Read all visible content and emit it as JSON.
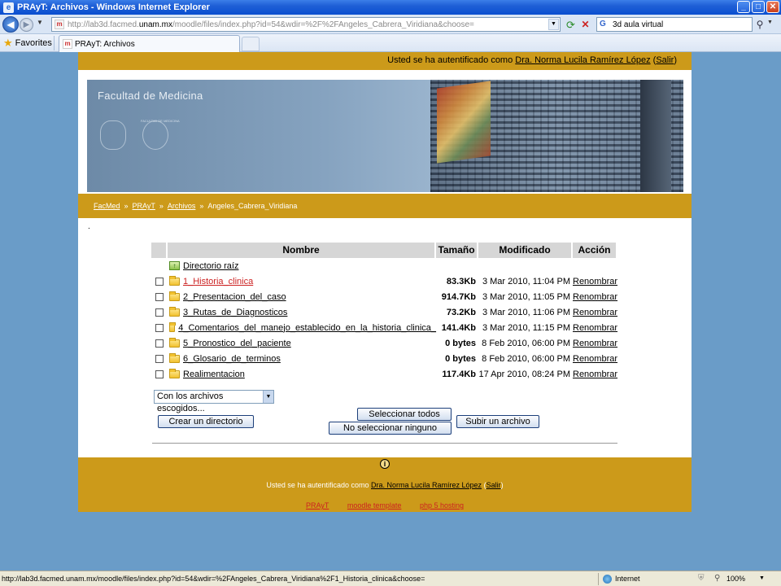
{
  "window": {
    "title": "PRAyT: Archivos - Windows Internet Explorer",
    "app_icon": "ie-icon"
  },
  "address": {
    "url_prefix": "http://lab3d.facmed.",
    "url_host": "unam.mx",
    "url_suffix": "/moodle/files/index.php?id=54&wdir=%2F%2FAngeles_Cabrera_Viridiana&choose=",
    "search_text": "3d aula virtual"
  },
  "favbar": {
    "favorites_label": "Favorites",
    "tab_label": "PRAyT: Archivos"
  },
  "page": {
    "auth_prefix": "Usted se ha autentificado como ",
    "auth_user": "Dra. Norma Lucila Ramírez López",
    "auth_logout": "Salir",
    "faculty_title": "Facultad de Medicina",
    "seal_label": "FACULTAD DE MEDICINA",
    "breadcrumb": [
      "FacMed",
      "PRAyT",
      "Archivos",
      "Angeles_Cabrera_Viridiana"
    ],
    "breadcrumb_sep": "»",
    "dot": "."
  },
  "table": {
    "headers": [
      "Nombre",
      "Tamaño",
      "Modificado",
      "Acción"
    ],
    "parent_label": " Directorio raíz",
    "rows": [
      {
        "name": " 1_Historia_clinica",
        "size": "83.3Kb",
        "modified": "3 Mar 2010, 11:04 PM",
        "action": "Renombrar",
        "highlight": true
      },
      {
        "name": " 2_Presentacion_del_caso",
        "size": "914.7Kb",
        "modified": "3 Mar 2010, 11:05 PM",
        "action": "Renombrar",
        "highlight": false
      },
      {
        "name": " 3_Rutas_de_Diagnosticos",
        "size": "73.2Kb",
        "modified": "3 Mar 2010, 11:06 PM",
        "action": "Renombrar",
        "highlight": false
      },
      {
        "name": " 4_Comentarios_del_manejo_establecido_en_la_historia_clinica_",
        "size": "141.4Kb",
        "modified": "3 Mar 2010, 11:15 PM",
        "action": "Renombrar",
        "highlight": false
      },
      {
        "name": " 5_Pronostico_del_paciente",
        "size": "0 bytes",
        "modified": "8 Feb 2010, 06:00 PM",
        "action": "Renombrar",
        "highlight": false
      },
      {
        "name": " 6_Glosario_de_terminos",
        "size": "0 bytes",
        "modified": "8 Feb 2010, 06:00 PM",
        "action": "Renombrar",
        "highlight": false
      },
      {
        "name": " Realimentacion",
        "size": "117.4Kb",
        "modified": "17 Apr 2010, 08:24 PM",
        "action": "Renombrar",
        "highlight": false
      }
    ]
  },
  "controls": {
    "with_selected": "Con los archivos escogidos...",
    "create_dir": "Crear un directorio",
    "select_all": "Seleccionar todos",
    "select_none": "No seleccionar ninguno",
    "upload": "Subir un archivo"
  },
  "footer": {
    "auth_prefix": "Usted se ha autentificado como ",
    "auth_user": "Dra. Norma Lucila Ramírez López",
    "auth_logout": "Salir",
    "links": [
      "PRAyT",
      "moodle template",
      "php 5 hosting"
    ]
  },
  "status": {
    "url": "http://lab3d.facmed.unam.mx/moodle/files/index.php?id=54&wdir=%2FAngeles_Cabrera_Viridiana%2F1_Historia_clinica&choose=",
    "zone": "Internet",
    "zoom": "100%"
  },
  "colors": {
    "gold": "#cc9a1a",
    "background": "#6a9cc8",
    "highlight_red": "#cc2222"
  }
}
